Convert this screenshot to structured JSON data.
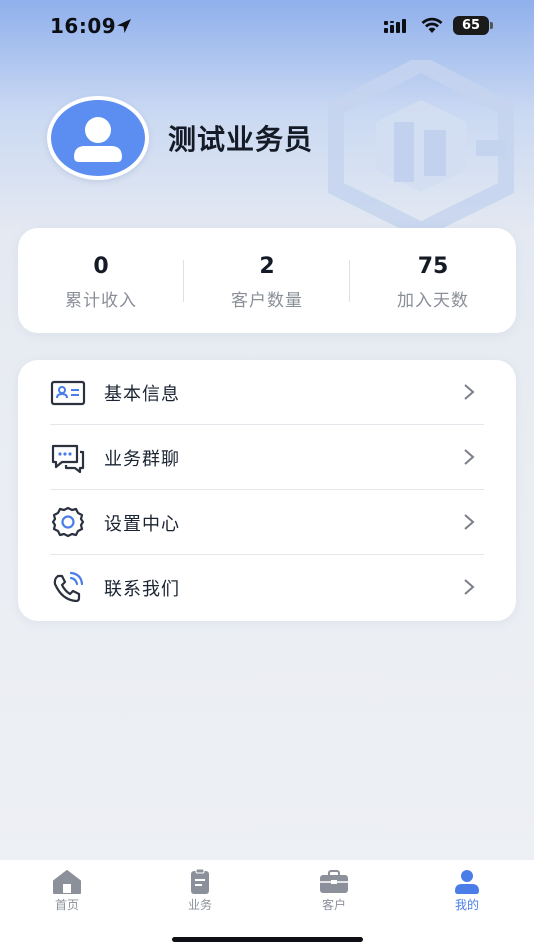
{
  "status_bar": {
    "time": "16:09",
    "battery": "65",
    "battery_level": 0.65,
    "icons": [
      "location-arrow-icon",
      "cellular-signal-icon",
      "wifi-icon",
      "battery-icon"
    ]
  },
  "profile": {
    "name": "测试业务员",
    "avatar_icon": "user-avatar-icon",
    "watermark_icon": "company-logo-watermark"
  },
  "stats": [
    {
      "value": "0",
      "label": "累计收入"
    },
    {
      "value": "2",
      "label": "客户数量"
    },
    {
      "value": "75",
      "label": "加入天数"
    }
  ],
  "menu": [
    {
      "label": "基本信息",
      "icon": "id-card-icon"
    },
    {
      "label": "业务群聊",
      "icon": "chat-bubbles-icon"
    },
    {
      "label": "设置中心",
      "icon": "gear-icon"
    },
    {
      "label": "联系我们",
      "icon": "phone-icon"
    }
  ],
  "tabs": [
    {
      "label": "首页",
      "icon": "home-icon",
      "active": false
    },
    {
      "label": "业务",
      "icon": "clipboard-icon",
      "active": false
    },
    {
      "label": "客户",
      "icon": "briefcase-icon",
      "active": false
    },
    {
      "label": "我的",
      "icon": "user-icon",
      "active": true
    }
  ],
  "colors": {
    "accent": "#4a7de8",
    "avatar_bg": "#5b8ef0",
    "text_primary": "#141a26",
    "text_secondary": "#8a8f98",
    "tab_inactive": "#8b909a"
  }
}
